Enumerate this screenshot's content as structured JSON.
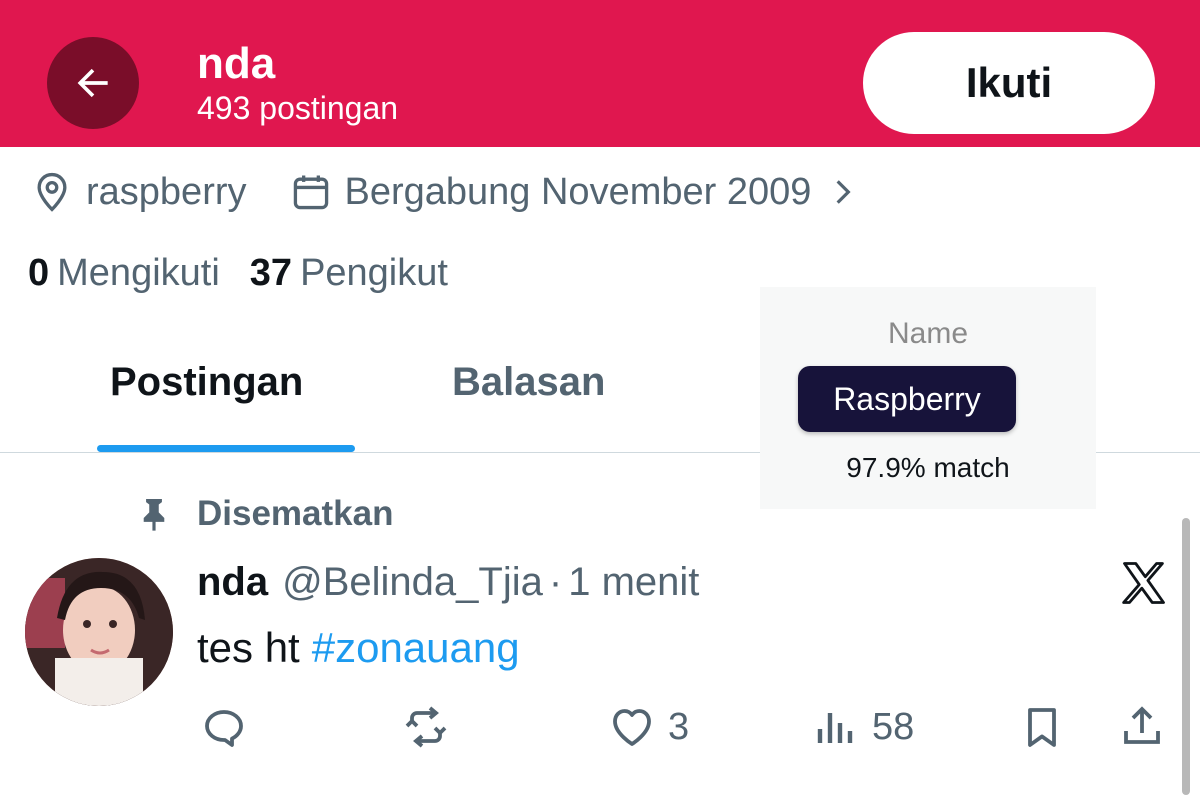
{
  "header": {
    "profile_name": "nda",
    "post_count": "493 postingan",
    "follow_label": "Ikuti",
    "background_color": "#e0174f"
  },
  "profile_meta": {
    "location": "raspberry",
    "joined": "Bergabung November 2009"
  },
  "stats": {
    "following_count": "0",
    "following_label": "Mengikuti",
    "followers_count": "37",
    "followers_label": "Pengikut"
  },
  "tabs": [
    {
      "label": "Postingan",
      "active": true
    },
    {
      "label": "Balasan",
      "active": false
    }
  ],
  "overlay": {
    "title": "Name",
    "value": "Raspberry",
    "match": "97.9% match"
  },
  "pinned_post": {
    "pinned_label": "Disematkan",
    "author_name": "nda",
    "handle": "@Belinda_Tjia",
    "separator": "·",
    "time": "1 menit",
    "text": "tes ht",
    "hashtag": "#zonauang",
    "likes": "3",
    "views": "58"
  },
  "icons": [
    "back-arrow-icon",
    "location-pin-icon",
    "calendar-icon",
    "chevron-right-icon",
    "pin-icon",
    "x-logo-icon",
    "reply-icon",
    "repost-icon",
    "like-icon",
    "views-icon",
    "bookmark-icon",
    "share-icon"
  ],
  "colors": {
    "accent_blue": "#1d9bf0",
    "muted_text": "#536471",
    "chip_bg": "#17133a"
  }
}
